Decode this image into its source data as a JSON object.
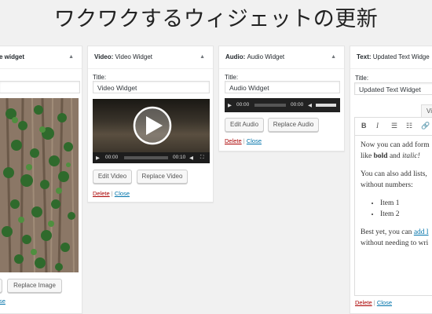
{
  "page": {
    "title": "ワクワクするウィジェットの更新"
  },
  "image_widget": {
    "header": "e widget",
    "buttons": {
      "edit": "",
      "replace": "Replace Image"
    },
    "links": {
      "close": "se"
    }
  },
  "video_widget": {
    "header_type": "Video:",
    "header_name": "Video Widget",
    "title_label": "Title:",
    "title_value": "Video Widget",
    "player": {
      "current_time": "00:00",
      "duration": "00:10"
    },
    "buttons": {
      "edit": "Edit Video",
      "replace": "Replace Video"
    },
    "links": {
      "delete": "Delete",
      "separator": "|",
      "close": "Close"
    }
  },
  "audio_widget": {
    "header_type": "Audio:",
    "header_name": "Audio Widget",
    "title_label": "Title:",
    "title_value": "Audio Widget",
    "player": {
      "current_time": "00:00",
      "duration": "00:00"
    },
    "buttons": {
      "edit": "Edit Audio",
      "replace": "Replace Audio"
    },
    "links": {
      "delete": "Delete",
      "separator": "|",
      "close": "Close"
    }
  },
  "text_widget": {
    "header_type": "Text:",
    "header_name": "Updated Text Widge",
    "title_label": "Title:",
    "title_value": "Updated Text Widget",
    "tab": "Vi",
    "content": {
      "p1_line1": "Now you can add form",
      "p1_like": "like ",
      "p1_bold": "bold",
      "p1_and": " and ",
      "p1_italic": "italic!",
      "p2_line1": "You can also add lists,",
      "p2_line2": "without numbers:",
      "items": [
        "Item 1",
        "Item 2"
      ],
      "p3_prefix": "Best yet, you can ",
      "p3_link": "add l",
      "p3_line2": "without needing to wri"
    },
    "links": {
      "delete": "Delete",
      "separator": "|",
      "close": "Close"
    }
  },
  "icons": {
    "collapse": "triangle-up-icon",
    "play": "play-icon",
    "volume": "volume-icon",
    "fullscreen": "fullscreen-icon",
    "bold": "bold-icon",
    "italic": "italic-icon",
    "bullet_list": "bullet-list-icon",
    "numbered_list": "numbered-list-icon",
    "link": "link-icon"
  },
  "colors": {
    "delete_link": "#aa0000",
    "close_link": "#0073aa",
    "background": "#f1f1f1"
  }
}
